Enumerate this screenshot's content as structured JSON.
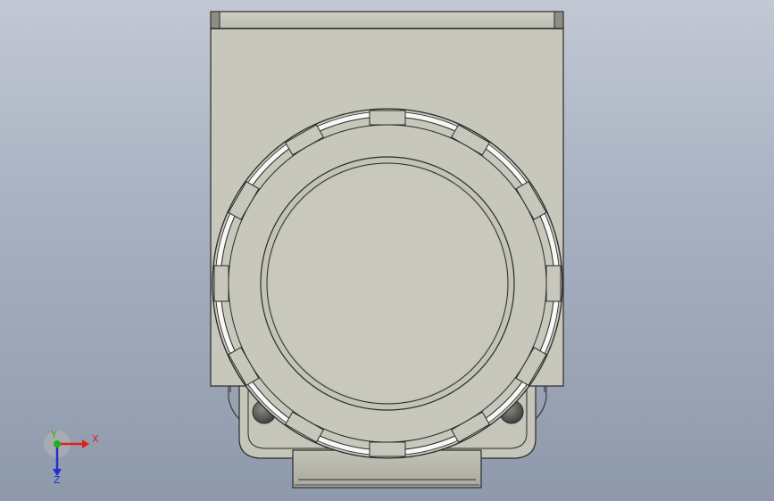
{
  "viewport": {
    "background_top": "#c2c8d4",
    "background_bottom": "#8e99ab",
    "part_color": "#c8c7bc",
    "edge_color": "#2a2a2a"
  },
  "triad": {
    "x_label": "X",
    "y_label": "Y",
    "z_label": "Z",
    "x_color": "#e02020",
    "y_color": "#20b020",
    "z_color": "#2030d0"
  }
}
